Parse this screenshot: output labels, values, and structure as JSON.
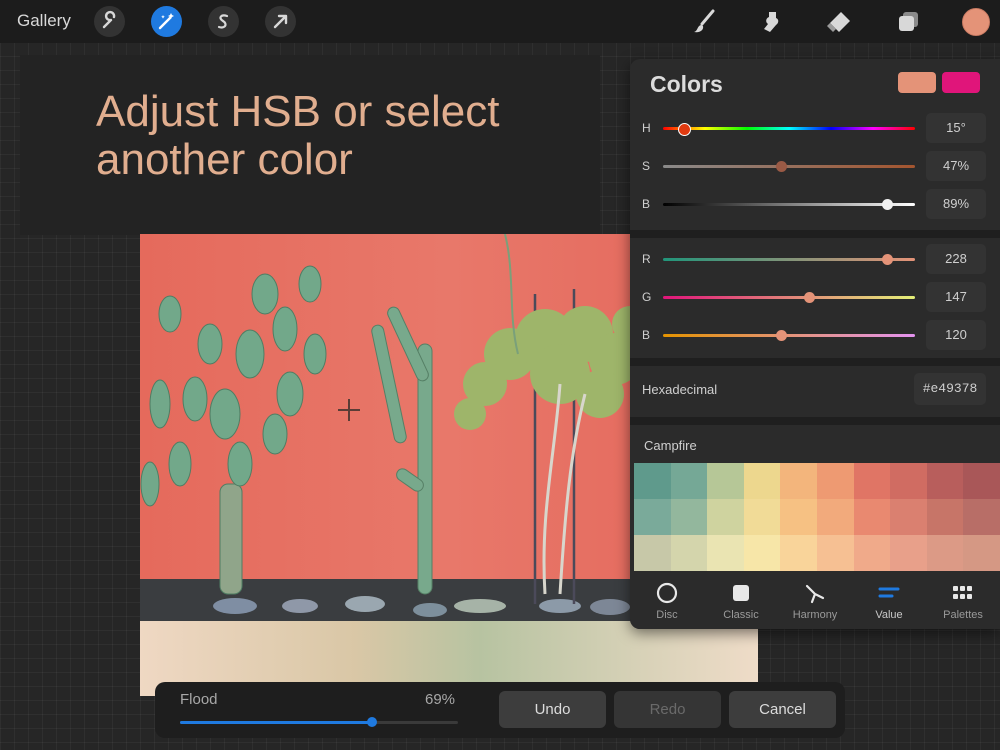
{
  "toolbar": {
    "gallery_label": "Gallery",
    "left_icons": [
      "wrench-icon",
      "magic-wand-icon",
      "selection-s-icon",
      "transform-arrow-icon"
    ],
    "right_icons": [
      "brush-icon",
      "smudge-icon",
      "eraser-icon",
      "layers-icon"
    ],
    "current_color": "#e49378"
  },
  "hint": {
    "text": "Adjust HSB or select another color"
  },
  "colors_panel": {
    "title": "Colors",
    "current_swatch": "#e49378",
    "previous_swatch": "#e0157a",
    "hsb": [
      {
        "label": "H",
        "value": "15°",
        "fraction": 0.08
      },
      {
        "label": "S",
        "value": "47%",
        "fraction": 0.47
      },
      {
        "label": "B",
        "value": "89%",
        "fraction": 0.89
      }
    ],
    "rgb": [
      {
        "label": "R",
        "value": "228",
        "fraction": 0.89
      },
      {
        "label": "G",
        "value": "147",
        "fraction": 0.58
      },
      {
        "label": "B",
        "value": "120",
        "fraction": 0.47
      }
    ],
    "hex_label": "Hexadecimal",
    "hex_value": "#e49378",
    "palette_name": "Campfire",
    "palette_colors": [
      [
        "#5f9a8c",
        "#75a896",
        "#b6c797",
        "#edd78e",
        "#f3b57c",
        "#ee9a72",
        "#e07565",
        "#d06c62",
        "#b85e5c",
        "#a95758"
      ],
      [
        "#7aaa9a",
        "#93b79d",
        "#cfd39f",
        "#f1db97",
        "#f6c183",
        "#f2aa7c",
        "#e98970",
        "#da8070",
        "#c77568",
        "#b86e67"
      ],
      [
        "#c7c8a8",
        "#d4d5ac",
        "#eae4b2",
        "#f7e6a8",
        "#f9d49a",
        "#f6c093",
        "#f0aa8a",
        "#e8a08a",
        "#dc9a86",
        "#d59884"
      ]
    ],
    "tabs": [
      {
        "label": "Disc",
        "icon": "disc-icon",
        "active": false
      },
      {
        "label": "Classic",
        "icon": "classic-square-icon",
        "active": false
      },
      {
        "label": "Harmony",
        "icon": "harmony-icon",
        "active": false
      },
      {
        "label": "Value",
        "icon": "value-sliders-icon",
        "active": true
      },
      {
        "label": "Palettes",
        "icon": "palettes-grid-icon",
        "active": false
      }
    ]
  },
  "flood": {
    "label": "Flood",
    "value": "69%",
    "fraction": 0.69,
    "undo_label": "Undo",
    "redo_label": "Redo",
    "cancel_label": "Cancel"
  },
  "colors": {
    "accent": "#1f7ae0",
    "hint_text": "#e1ae8f"
  }
}
